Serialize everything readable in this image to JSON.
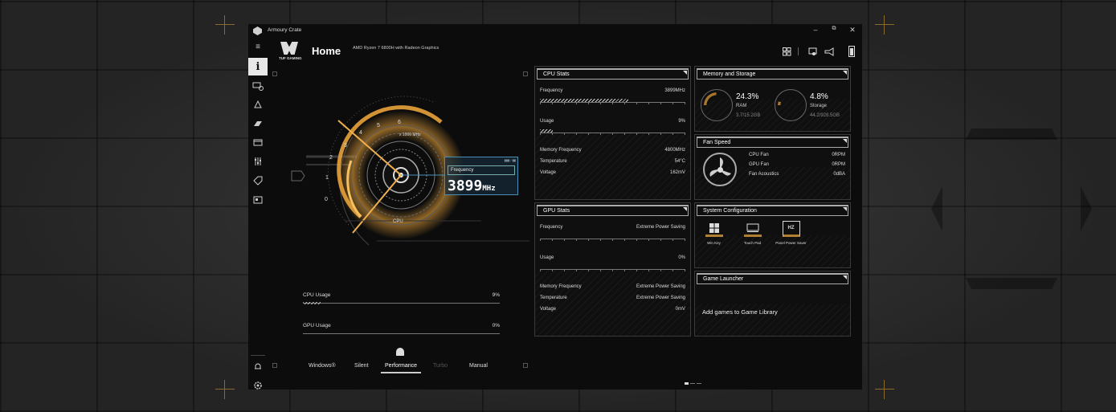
{
  "app": {
    "title": "Armoury Crate",
    "brand_text": "TUF GAMING",
    "page_title": "Home",
    "cpu_model": "AMD Ryzen 7 6800H with Radeon Graphics"
  },
  "gauge": {
    "scale_labels": [
      "0",
      "1",
      "2",
      "3",
      "4",
      "5",
      "6"
    ],
    "multiplier_label": "x 1000 MHz",
    "center_label": "CPU",
    "freq_box": {
      "label": "Frequency",
      "value": "3899",
      "unit": "MHz"
    }
  },
  "usage": {
    "cpu": {
      "label": "CPU Usage",
      "value": "9%",
      "fraction": 0.09
    },
    "gpu": {
      "label": "GPU Usage",
      "value": "0%",
      "fraction": 0.0
    }
  },
  "modes": {
    "items": [
      {
        "label": "Windows®",
        "state": "normal"
      },
      {
        "label": "Silent",
        "state": "normal"
      },
      {
        "label": "Performance",
        "state": "active"
      },
      {
        "label": "Turbo",
        "state": "disabled"
      },
      {
        "label": "Manual",
        "state": "normal"
      }
    ]
  },
  "cpu_stats": {
    "title": "CPU Stats",
    "frequency": {
      "label": "Frequency",
      "value": "3899MHz",
      "fraction": 0.6
    },
    "usage": {
      "label": "Usage",
      "value": "9%",
      "fraction": 0.09
    },
    "memory_frequency": {
      "label": "Memory Frequency",
      "value": "4800MHz"
    },
    "temperature": {
      "label": "Temperature",
      "value": "54°C"
    },
    "voltage": {
      "label": "Voltage",
      "value": "162mV"
    }
  },
  "gpu_stats": {
    "title": "GPU Stats",
    "frequency": {
      "label": "Frequency",
      "value": "Extreme Power Saving"
    },
    "usage": {
      "label": "Usage",
      "value": "0%"
    },
    "memory_frequency": {
      "label": "Memory Frequency",
      "value": "Extreme Power Saving"
    },
    "temperature": {
      "label": "Temperature",
      "value": "Extreme Power Saving"
    },
    "voltage": {
      "label": "Voltage",
      "value": "0mV"
    }
  },
  "memory": {
    "title": "Memory and Storage",
    "ram": {
      "percent": "24.3%",
      "label": "RAM",
      "detail": "3.7/15.2GB",
      "fraction": 0.243
    },
    "storage": {
      "percent": "4.8%",
      "label": "Storage",
      "detail": "44.2/928.5GB",
      "fraction": 0.048
    }
  },
  "fan": {
    "title": "Fan Speed",
    "rows": [
      {
        "label": "CPU Fan",
        "value": "0RPM"
      },
      {
        "label": "GPU Fan",
        "value": "0RPM"
      },
      {
        "label": "Fan Acoustics",
        "value": "0dBA"
      }
    ]
  },
  "system_config": {
    "title": "System Configuration",
    "items": [
      {
        "label": "Win Key",
        "icon": "windows-key-icon"
      },
      {
        "label": "Touch Pad",
        "icon": "touchpad-icon"
      },
      {
        "label": "Panel Power Saver",
        "icon": "hz-icon",
        "glyph": "HZ"
      }
    ]
  },
  "game_launcher": {
    "title": "Game Launcher",
    "empty_text": "Add games to Game Library"
  },
  "colors": {
    "accent": "#e8a23a",
    "highlight": "#4a8fb3"
  }
}
